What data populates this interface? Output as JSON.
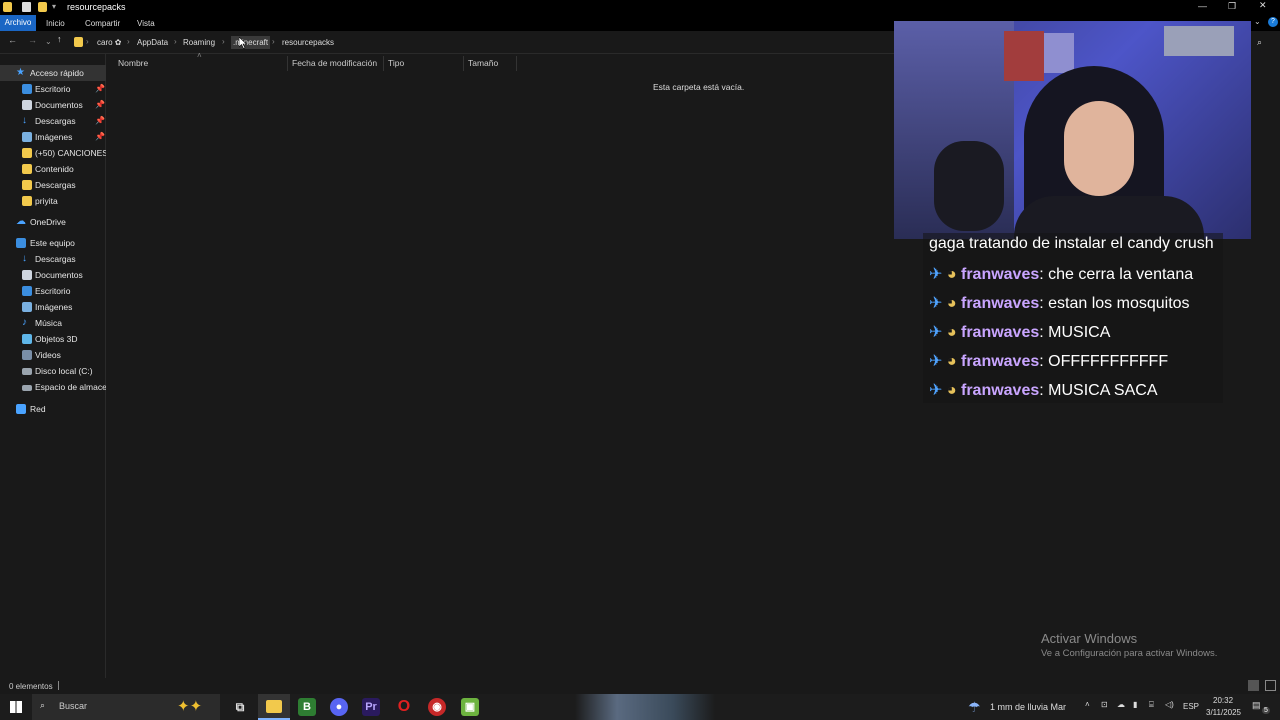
{
  "window": {
    "title": "resourcepacks"
  },
  "ribbon": {
    "tabs": [
      "Archivo",
      "Inicio",
      "Compartir",
      "Vista"
    ]
  },
  "address": {
    "crumbs": [
      "caro ✿",
      "AppData",
      "Roaming",
      ".minecraft",
      "resourcepacks"
    ]
  },
  "columns": [
    "Nombre",
    "Fecha de modificación",
    "Tipo",
    "Tamaño"
  ],
  "empty_message": "Esta carpeta está vacía.",
  "nav": {
    "quick_access": "Acceso rápido",
    "quick_items": [
      "Escritorio",
      "Documentos",
      "Descargas",
      "Imágenes",
      "(+50) CANCIONES (",
      "Contenido",
      "Descargas",
      "priyita"
    ],
    "onedrive": "OneDrive",
    "this_pc": "Este equipo",
    "pc_items": [
      "Descargas",
      "Documentos",
      "Escritorio",
      "Imágenes",
      "Música",
      "Objetos 3D",
      "Videos",
      "Disco local (C:)",
      "Espacio de almacen"
    ],
    "network": "Red"
  },
  "status": {
    "items_count": "0 elementos"
  },
  "chat": {
    "top_line": "gaga tratando de instalar el candy crush",
    "messages": [
      {
        "user": "franwaves",
        "text": ": che cerra la ventana"
      },
      {
        "user": "franwaves",
        "text": ": estan los mosquitos"
      },
      {
        "user": "franwaves",
        "text": ": MUSICA"
      },
      {
        "user": "franwaves",
        "text": ": OFFFFFFFFFFF"
      },
      {
        "user": "franwaves",
        "text": ": MUSICA SACA"
      }
    ]
  },
  "watermark": {
    "title": "Activar Windows",
    "subtitle": "Ve a Configuración para activar Windows."
  },
  "taskbar": {
    "search_placeholder": "Buscar",
    "weather": "1 mm de lluvia Mar",
    "language": "ESP",
    "time": "20:32",
    "date": "3/11/2025",
    "notification_count": "5"
  }
}
